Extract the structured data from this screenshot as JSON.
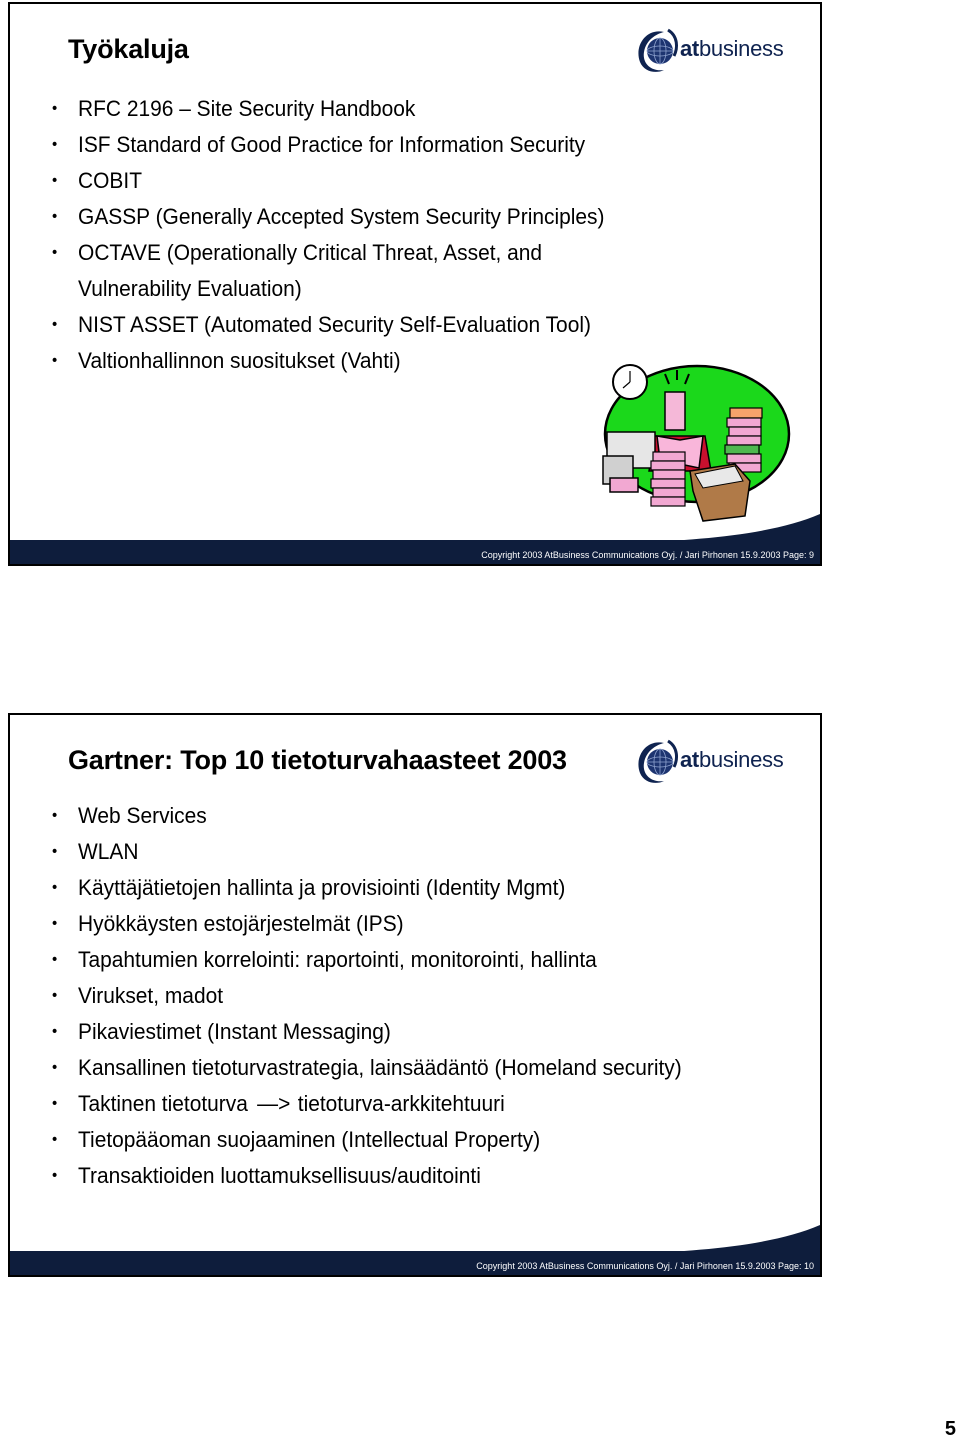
{
  "slides": [
    {
      "title": "Työkaluja",
      "logo_text_bold": "at",
      "logo_text_regular": "business",
      "bullets": [
        {
          "text": "RFC 2196 – Site Security Handbook"
        },
        {
          "text": "ISF Standard of Good Practice for Information Security"
        },
        {
          "text": "COBIT"
        },
        {
          "text": "GASSP (Generally Accepted System Security Principles)"
        },
        {
          "text": "OCTAVE (Operationally Critical Threat, Asset, and",
          "continuation": "Vulnerability Evaluation)"
        },
        {
          "text": "NIST ASSET (Automated Security Self-Evaluation Tool)"
        },
        {
          "text": "Valtionhallinnon suositukset (Vahti)"
        }
      ],
      "clipart": "busy-office-worker-illustration",
      "footer": "Copyright 2003 AtBusiness Communications Oyj.  / Jari Pirhonen 15.9.2003  Page: 9"
    },
    {
      "title": "Gartner: Top 10 tietoturvahaasteet 2003",
      "logo_text_bold": "at",
      "logo_text_regular": "business",
      "bullets": [
        {
          "text": "Web Services"
        },
        {
          "text": "WLAN"
        },
        {
          "text": "Käyttäjätietojen hallinta ja provisiointi (Identity Mgmt)"
        },
        {
          "text": "Hyökkäysten estojärjestelmät (IPS)"
        },
        {
          "text": "Tapahtumien korrelointi: raportointi, monitorointi, hallinta"
        },
        {
          "text": "Virukset, madot"
        },
        {
          "text": "Pikaviestimet (Instant Messaging)"
        },
        {
          "text": "Kansallinen tietoturvastrategia, lainsäädäntö (Homeland security)"
        },
        {
          "text_before": "Taktinen tietoturva",
          "arrow": "—>",
          "text_after": "tietoturva-arkkitehtuuri"
        },
        {
          "text": "Tietopääoman suojaaminen (Intellectual Property)"
        },
        {
          "text": "Transaktioiden luottamuksellisuus/auditointi"
        }
      ],
      "footer": "Copyright 2003 AtBusiness Communications Oyj.  / Jari Pirhonen 15.9.2003  Page: 10"
    }
  ],
  "bullet_glyph": "•",
  "page_number": "5",
  "colors": {
    "footer_bar": "#0e1d3c",
    "logo_blue": "#0f2350",
    "clipart_green": "#1bd81b"
  }
}
